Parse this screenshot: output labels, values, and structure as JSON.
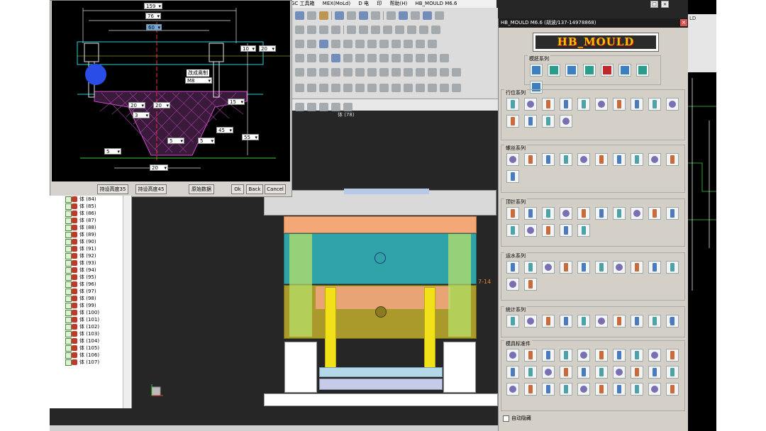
{
  "nx": {
    "menu": [
      "GC 工具箱",
      "MEX(MoLd)",
      "D 电",
      "印",
      "帮助(H)",
      "HB_MOULD M6.6"
    ],
    "body_count_label": "体 (78)",
    "fragment_label": "7-14",
    "right_fragment": "LD"
  },
  "dialog": {
    "dims": {
      "d159": "159",
      "d76": "76",
      "d60": "60",
      "d10": "10",
      "d20a": "20",
      "d15": "15",
      "d20b": "20",
      "d20c": "20",
      "d3": "3",
      "d45": "45",
      "d55": "55",
      "d5a": "5",
      "d5b": "5",
      "d5c": "5",
      "d20d": "20"
    },
    "change_label": "改成奥制",
    "m8": "M8",
    "buttons": {
      "preset35": "持设高度35",
      "preset45": "持设高度45",
      "original": "原始数据",
      "ok": "Ok",
      "back": "Back",
      "cancel": "Cancel"
    }
  },
  "parts_prefix": "体",
  "parts": [
    "(84)",
    "(85)",
    "(86)",
    "(87)",
    "(88)",
    "(89)",
    "(90)",
    "(91)",
    "(92)",
    "(93)",
    "(94)",
    "(95)",
    "(96)",
    "(97)",
    "(98)",
    "(99)",
    "(100)",
    "(101)",
    "(102)",
    "(103)",
    "(104)",
    "(105)",
    "(106)",
    "(107)"
  ],
  "hb_panel": {
    "title": "HB_MOULD M6.6 (胡波/137-14978868)",
    "logo": "HB_MOULD",
    "groups": [
      {
        "label": "模胚系列",
        "count": 8
      },
      {
        "label": "行位系列",
        "count": 14
      },
      {
        "label": "螺丝系列",
        "count": 11
      },
      {
        "label": "顶针系列",
        "count": 15
      },
      {
        "label": "运水系列",
        "count": 12
      },
      {
        "label": "统计系列",
        "count": 10
      },
      {
        "label": "模具标准件",
        "count": 30
      }
    ],
    "autohide": "自动隐藏",
    "stat_last_icon": "P"
  },
  "colors": {
    "plate_orange": "#f4a877",
    "plate_teal": "#2fa3a8",
    "plate_olive": "#a99a2b",
    "pin_yellow": "#f2e018",
    "panel_bg": "#d4d0c8"
  }
}
